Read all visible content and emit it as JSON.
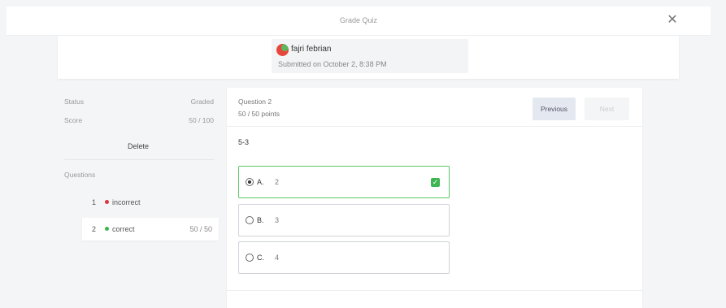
{
  "header": {
    "title": "Grade Quiz",
    "close_glyph": "✕"
  },
  "submission": {
    "student_name": "fajri febrian",
    "submitted_text": "Submitted on October 2, 8:38 PM"
  },
  "sidebar": {
    "status_label": "Status",
    "status_value": "Graded",
    "score_label": "Score",
    "score_value": "50 / 100",
    "delete_label": "Delete",
    "questions_label": "Questions",
    "questions": [
      {
        "number": "1",
        "status": "incorrect",
        "points": "",
        "dot_color": "#d9363e"
      },
      {
        "number": "2",
        "status": "correct",
        "points": "50 / 50",
        "dot_color": "#3db552"
      }
    ]
  },
  "question": {
    "title": "Question 2",
    "points": "50 / 50 points",
    "previous_label": "Previous",
    "next_label": "Next",
    "prompt": "5-3",
    "options": [
      {
        "letter": "A.",
        "text": "2",
        "selected": true,
        "correct": true
      },
      {
        "letter": "B.",
        "text": "3",
        "selected": false,
        "correct": false
      },
      {
        "letter": "C.",
        "text": "4",
        "selected": false,
        "correct": false
      }
    ]
  },
  "colors": {
    "correct": "#3db552",
    "incorrect": "#d9363e",
    "selected_border": "#5cc86b"
  }
}
